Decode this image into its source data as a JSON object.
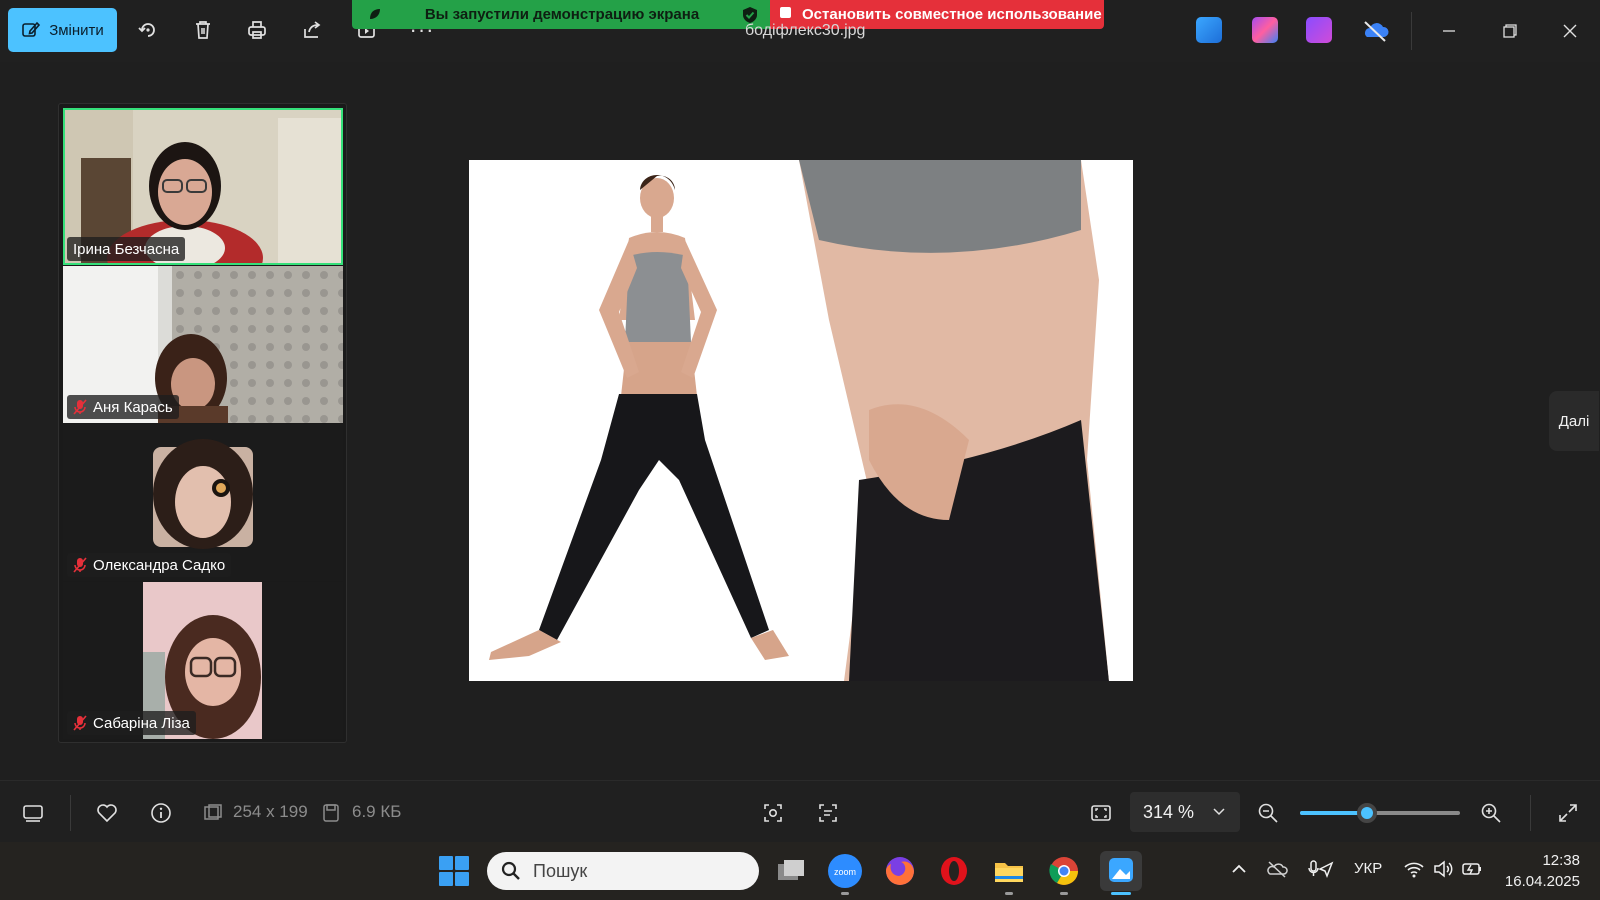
{
  "toolbar": {
    "edit_label": "Змінити",
    "file_name": "бодіфлекс30.jpg",
    "share_banner": "Вы запустили демонстрацию экрана",
    "stop_share_label": "Остановить совместное использование",
    "more_label": "···"
  },
  "participants": [
    {
      "name": "Ірина Безчасна",
      "muted": false,
      "active": true
    },
    {
      "name": "Аня Карась",
      "muted": true,
      "active": false
    },
    {
      "name": "Олександра Садко",
      "muted": true,
      "active": false
    },
    {
      "name": "Сабаріна Ліза",
      "muted": true,
      "active": false
    }
  ],
  "viewer": {
    "next_label": "Далі",
    "dimensions": "254 x 199",
    "file_size": "6.9 КБ",
    "zoom_value": "314 %",
    "zoom_level": 0.42
  },
  "taskbar": {
    "search_placeholder": "Пошук",
    "language": "УКР",
    "time": "12:38",
    "date": "16.04.2025"
  },
  "colors": {
    "accent": "#4cc2ff",
    "share_green": "#24a148",
    "stop_red": "#e5303a",
    "active_speaker": "#35e07a"
  }
}
